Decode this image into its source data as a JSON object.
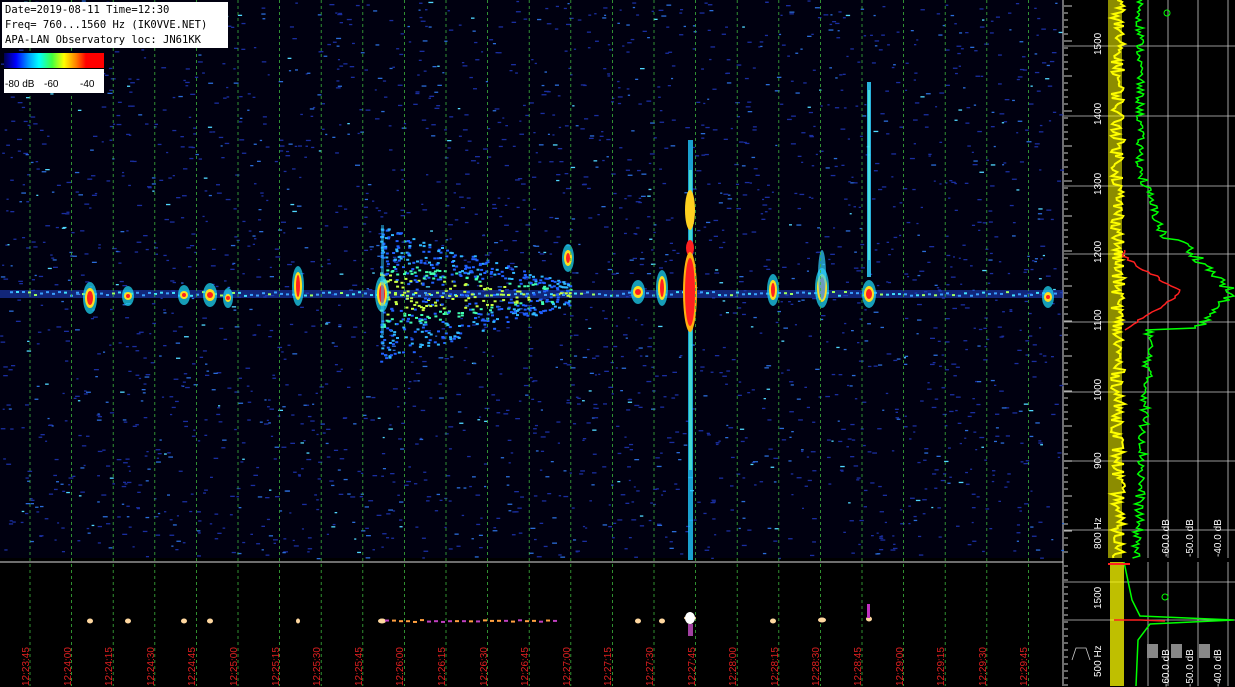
{
  "header": {
    "line1": "Date=2019-08-11 Time=12:30",
    "line2": "Freq= 760...1560 Hz (IK0VVE.NET)",
    "line3": "APA-LAN Observatory loc: JN61KK"
  },
  "colorbar": {
    "label_left": "-80 dB",
    "label_mid": "-60",
    "label_right": "-40"
  },
  "time_axis": {
    "labels": [
      "12:23:45",
      "12:24:00",
      "12:24:15",
      "12:24:30",
      "12:24:45",
      "12:25:00",
      "12:25:15",
      "12:25:30",
      "12:25:45",
      "12:26:00",
      "12:26:15",
      "12:26:30",
      "12:26:45",
      "12:27:00",
      "12:27:15",
      "12:27:30",
      "12:27:45",
      "12:28:00",
      "12:28:15",
      "12:28:30",
      "12:28:45",
      "12:29:00",
      "12:29:15",
      "12:29:30",
      "12:29:45"
    ]
  },
  "freq_axis": {
    "labels": [
      "1500",
      "1400",
      "1300",
      "1200",
      "1100",
      "1000",
      "900",
      "800 Hz"
    ],
    "lower_labels": [
      "1500",
      "500 Hz"
    ]
  },
  "spectrum_axis": {
    "labels": [
      "-60.0 dB",
      "-50.0 dB",
      "-40.0 dB"
    ]
  },
  "colors": {
    "background": "#000010",
    "grid_green": "#3cb43c",
    "time_label": "#e02020",
    "spectrum_avg": "#ffff00",
    "spectrum_peak": "#00ff00",
    "spectrum_red": "#ff2020"
  }
}
